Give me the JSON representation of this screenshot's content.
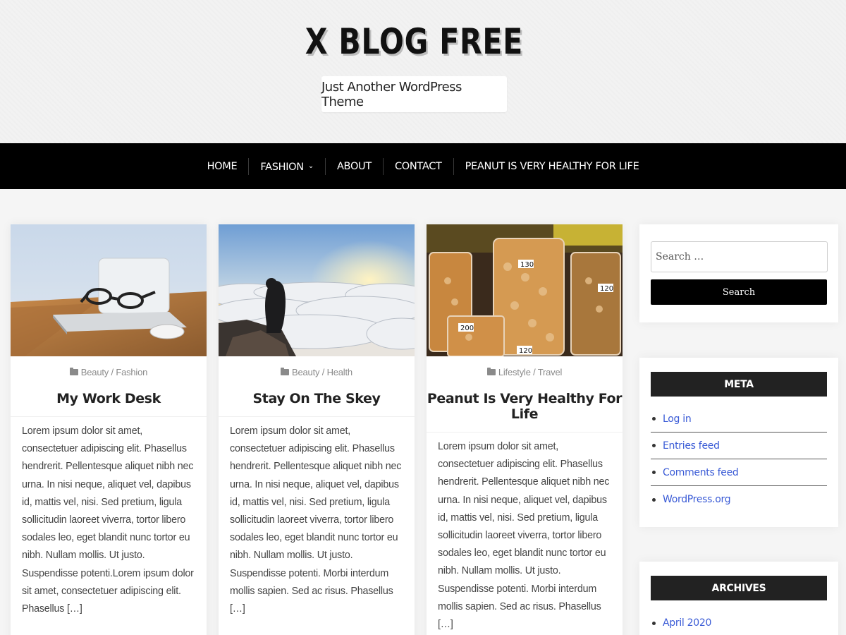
{
  "header": {
    "site_title": "X BLOG FREE",
    "site_description": "Just Another WordPress Theme"
  },
  "nav": {
    "items": [
      {
        "label": "HOME"
      },
      {
        "label": "FASHION",
        "has_submenu": true
      },
      {
        "label": "ABOUT"
      },
      {
        "label": "CONTACT"
      },
      {
        "label": "PEANUT IS VERY HEALTHY FOR LIFE"
      }
    ],
    "submenu_icon": "chevron-down-icon"
  },
  "posts": [
    {
      "categories": [
        "Beauty",
        "Fashion"
      ],
      "title": "My Work Desk",
      "excerpt": "Lorem ipsum dolor sit amet, consectetuer adipiscing elit. Phasellus hendrerit. Pellentesque aliquet nibh nec urna. In nisi neque, aliquet vel, dapibus id, mattis vel, nisi. Sed pretium, ligula sollicitudin laoreet viverra, tortor libero sodales leo, eget blandit nunc tortor eu nibh. Nullam mollis. Ut justo. Suspendisse potenti.Lorem ipsum dolor sit amet, consectetuer adipiscing elit. Phasellus […]",
      "image": "laptop-glasses-desk"
    },
    {
      "categories": [
        "Beauty",
        "Health"
      ],
      "title": "Stay On The Skey",
      "excerpt": "Lorem ipsum dolor sit amet, consectetuer adipiscing elit. Phasellus hendrerit. Pellentesque aliquet nibh nec urna. In nisi neque, aliquet vel, dapibus id, mattis vel, nisi. Sed pretium, ligula sollicitudin laoreet viverra, tortor libero sodales leo, eget blandit nunc tortor eu nibh. Nullam mollis. Ut justo. Suspendisse potenti. Morbi interdum mollis sapien. Sed ac risus. Phasellus […]",
      "image": "man-above-clouds"
    },
    {
      "categories": [
        "Lifestyle",
        "Travel"
      ],
      "title": "Peanut Is Very Healthy For Life",
      "excerpt": "Lorem ipsum dolor sit amet, consectetuer adipiscing elit. Phasellus hendrerit. Pellentesque aliquet nibh nec urna. In nisi neque, aliquet vel, dapibus id, mattis vel, nisi. Sed pretium, ligula sollicitudin laoreet viverra, tortor libero sodales leo, eget blandit nunc tortor eu nibh. Nullam mollis. Ut justo. Suspendisse potenti. Morbi interdum mollis sapien. Sed ac risus. Phasellus […]",
      "image": "bags-of-nuts",
      "price_tags": [
        "130",
        "120",
        "200",
        "120"
      ]
    }
  ],
  "sidebar": {
    "search": {
      "placeholder": "Search …",
      "button_label": "Search"
    },
    "meta": {
      "title": "META",
      "items": [
        "Log in",
        "Entries feed",
        "Comments feed",
        "WordPress.org"
      ]
    },
    "archives": {
      "title": "ARCHIVES",
      "items": [
        "April 2020"
      ]
    }
  },
  "colors": {
    "nav_background": "#000000",
    "link": "#3a5bd6",
    "widget_title_background": "#222222"
  }
}
